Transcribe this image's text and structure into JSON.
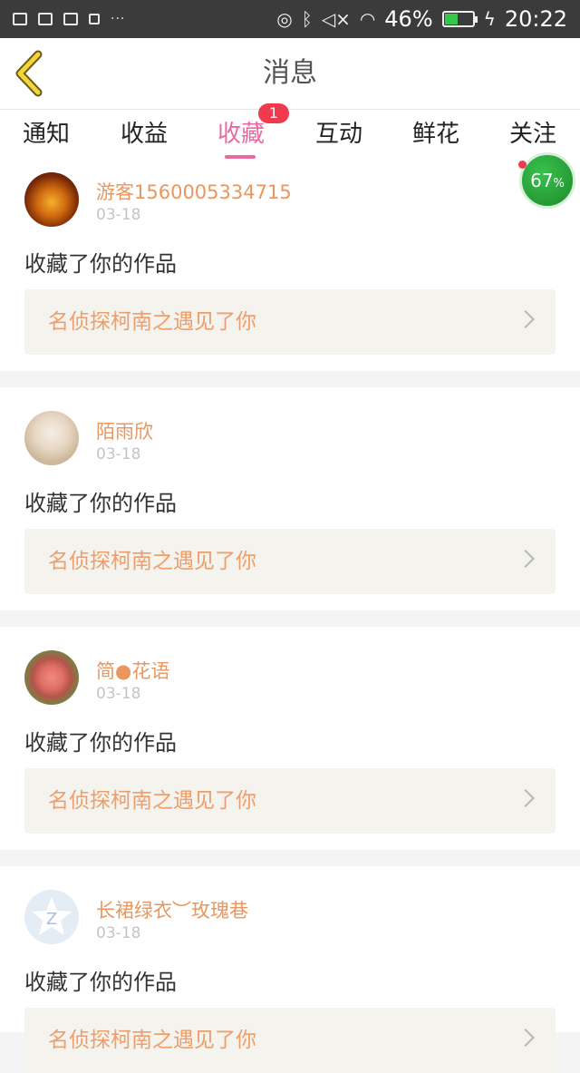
{
  "status_bar": {
    "battery_percent": "46%",
    "battery_level": 0.46,
    "time": "20:22",
    "icons": [
      "image-icon",
      "calendar-icon",
      "calendar-icon",
      "ad-icon",
      "more-icon",
      "nfc-icon",
      "bluetooth-icon",
      "mute-icon",
      "wifi-icon",
      "battery-icon",
      "charging-icon"
    ]
  },
  "header": {
    "title": "消息"
  },
  "tabs": {
    "items": [
      {
        "label": "通知"
      },
      {
        "label": "收益"
      },
      {
        "label": "收藏"
      },
      {
        "label": "互动"
      },
      {
        "label": "鲜花"
      },
      {
        "label": "关注"
      }
    ],
    "active_index": 2,
    "badge": "1"
  },
  "float_badge": {
    "value": "67",
    "unit": "%"
  },
  "feed": {
    "items": [
      {
        "username": "游客1560005334715",
        "date": "03-18",
        "action": "收藏了你的作品",
        "work_title": "名侦探柯南之遇见了你"
      },
      {
        "username": "陌雨欣",
        "date": "03-18",
        "action": "收藏了你的作品",
        "work_title": "名侦探柯南之遇见了你"
      },
      {
        "username": "简●花语",
        "date": "03-18",
        "action": "收藏了你的作品",
        "work_title": "名侦探柯南之遇见了你"
      },
      {
        "username": "长裙绿衣︶玫瑰巷",
        "date": "03-18",
        "action": "收藏了你的作品",
        "work_title": "名侦探柯南之遇见了你"
      }
    ]
  },
  "colors": {
    "accent_pink": "#e86aa0",
    "username_orange": "#e9975e",
    "work_title_orange": "#ee9e6a",
    "badge_red": "#ef3b4d",
    "float_green": "#2ea83f"
  }
}
